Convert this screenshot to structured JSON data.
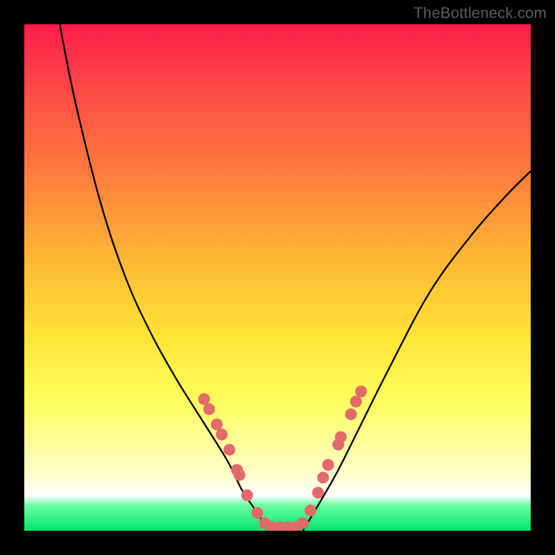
{
  "watermark": "TheBottleneck.com",
  "chart_data": {
    "type": "line",
    "title": "",
    "xlabel": "",
    "ylabel": "",
    "xlim": [
      0,
      100
    ],
    "ylim": [
      0,
      100
    ],
    "series": [
      {
        "name": "bottleneck-curve-left",
        "x": [
          7,
          10,
          15,
          20,
          25,
          30,
          35,
          40,
          43,
          45,
          47,
          49
        ],
        "y": [
          100,
          85,
          65,
          50,
          39,
          30,
          22,
          14,
          8,
          5,
          2,
          0
        ]
      },
      {
        "name": "bottleneck-curve-right",
        "x": [
          55,
          58,
          62,
          66,
          72,
          80,
          88,
          95,
          100
        ],
        "y": [
          0,
          5,
          12,
          20,
          32,
          47,
          58,
          66,
          71
        ]
      }
    ],
    "markers": {
      "name": "highlight-dots",
      "color": "#e26a6a",
      "points": [
        {
          "x": 35.5,
          "y": 26
        },
        {
          "x": 36.5,
          "y": 24
        },
        {
          "x": 38,
          "y": 21
        },
        {
          "x": 39,
          "y": 19
        },
        {
          "x": 40.5,
          "y": 16
        },
        {
          "x": 42,
          "y": 12
        },
        {
          "x": 42.5,
          "y": 11
        },
        {
          "x": 44,
          "y": 7
        },
        {
          "x": 46,
          "y": 3.5
        },
        {
          "x": 47.5,
          "y": 1.5
        },
        {
          "x": 49,
          "y": 0.7
        },
        {
          "x": 50.5,
          "y": 0.7
        },
        {
          "x": 52,
          "y": 0.7
        },
        {
          "x": 53.5,
          "y": 0.7
        },
        {
          "x": 55,
          "y": 1.5
        },
        {
          "x": 56.5,
          "y": 4
        },
        {
          "x": 58,
          "y": 7.5
        },
        {
          "x": 59,
          "y": 10.5
        },
        {
          "x": 60,
          "y": 13
        },
        {
          "x": 62,
          "y": 17
        },
        {
          "x": 62.5,
          "y": 18.5
        },
        {
          "x": 64.5,
          "y": 23
        },
        {
          "x": 65.5,
          "y": 25.5
        },
        {
          "x": 66.5,
          "y": 27.5
        }
      ]
    },
    "gradient_stops": [
      {
        "pos": 0,
        "color": "#ff1c4a"
      },
      {
        "pos": 12,
        "color": "#ff4747"
      },
      {
        "pos": 30,
        "color": "#ff7e3d"
      },
      {
        "pos": 45,
        "color": "#ffb236"
      },
      {
        "pos": 62,
        "color": "#ffe535"
      },
      {
        "pos": 75,
        "color": "#ffff60"
      },
      {
        "pos": 85,
        "color": "#ffffad"
      },
      {
        "pos": 90,
        "color": "#ffffd6"
      },
      {
        "pos": 93,
        "color": "#ffffff"
      },
      {
        "pos": 95,
        "color": "#6cffa2"
      },
      {
        "pos": 100,
        "color": "#00e46a"
      }
    ]
  }
}
